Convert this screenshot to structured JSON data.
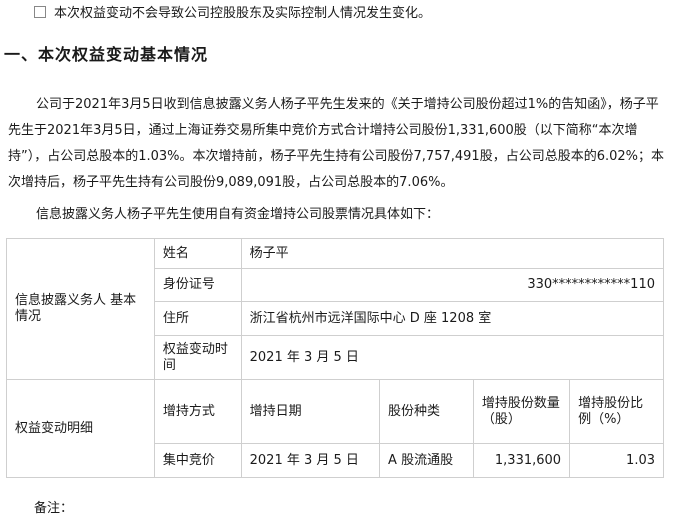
{
  "bullet": {
    "text": "本次权益变动不会导致公司控股股东及实际控制人情况发生变化。"
  },
  "heading": "一、本次权益变动基本情况",
  "paragraph1": "公司于2021年3月5日收到信息披露义务人杨子平先生发来的《关于增持公司股份超过1%的告知函》，杨子平先生于2021年3月5日，通过上海证券交易所集中竞价方式合计增持公司股份1,331,600股（以下简称“本次增持”），占公司总股本的1.03%。本次增持前，杨子平先生持有公司股份7,757,491股，占公司总股本的6.02%；本次增持后，杨子平先生持有公司股份9,089,091股，占公司总股本的7.06%。",
  "paragraph2": "信息披露义务人杨子平先生使用自有资金增持公司股票情况具体如下：",
  "table": {
    "section1_label": "信息披露义务人 基本情况",
    "name_label": "姓名",
    "name_value": "杨子平",
    "id_label": "身份证号",
    "id_value": "330************110",
    "address_label": "住所",
    "address_value": "浙江省杭州市远洋国际中心 D 座 1208 室",
    "date_label": "权益变动时间",
    "date_value": "2021 年 3 月 5 日",
    "section2_label": "权益变动明细",
    "headers": [
      "增持方式",
      "增持日期",
      "股份种类",
      "增持股份数量（股）",
      "增持股份比例（%）"
    ],
    "row": [
      "集中竞价",
      "2021 年 3 月 5 日",
      "A 股流通股",
      "1,331,600",
      "1.03"
    ]
  },
  "note": "备注："
}
